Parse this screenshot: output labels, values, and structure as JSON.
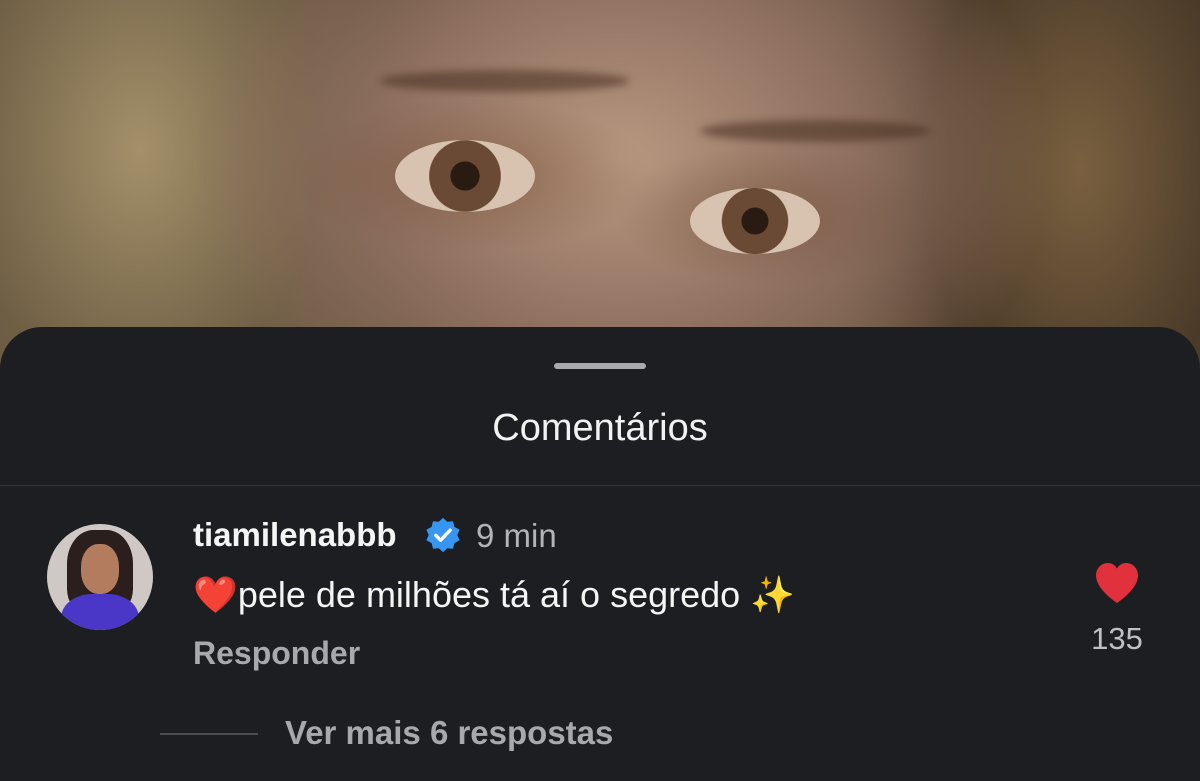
{
  "sheet": {
    "title": "Comentários"
  },
  "comment": {
    "username": "tiamilenabbb",
    "verified": true,
    "time": "9 min",
    "leading_emoji": "❤️",
    "text": "pele de milhões tá aí o segredo",
    "trailing_emoji": "✨",
    "reply_label": "Responder",
    "like_count": "135",
    "like_color": "#e0313c",
    "more_replies_label": "Ver mais 6 respostas"
  },
  "icons": {
    "verified": "verified-badge-icon",
    "like": "heart-icon"
  }
}
